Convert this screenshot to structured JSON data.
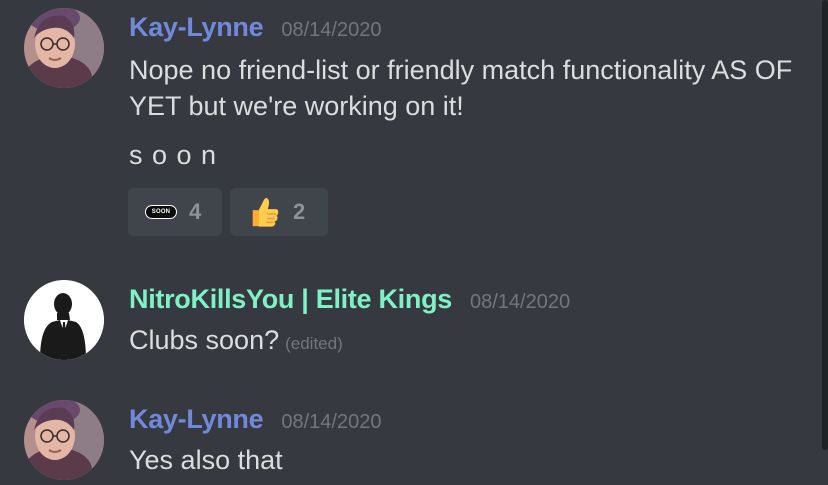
{
  "messages": [
    {
      "username": "Kay-Lynne",
      "username_color": "#7289da",
      "timestamp": "08/14/2020",
      "avatar_icon": "user-photo-avatar",
      "lines": [
        "Nope no friend-list or friendly match functionality AS OF YET but we're working on it!",
        "s o o n"
      ],
      "reactions": [
        {
          "emoji": "soon-emoji",
          "emoji_text": "SOON",
          "count": "4"
        },
        {
          "emoji": "thumbs-up-emoji",
          "count": "2"
        }
      ]
    },
    {
      "username": "NitroKillsYou | Elite Kings",
      "username_color": "#7ff2c5",
      "timestamp": "08/14/2020",
      "avatar_icon": "businessman-silhouette-avatar",
      "text": "Clubs soon?",
      "edited_label": "(edited)"
    },
    {
      "username": "Kay-Lynne",
      "username_color": "#7289da",
      "timestamp": "08/14/2020",
      "avatar_icon": "user-photo-avatar",
      "text": "Yes also that"
    }
  ],
  "colors": {
    "background": "#36393f",
    "message_text": "#dcddde",
    "timestamp": "#72767d",
    "reaction_bg": "#40444b"
  }
}
